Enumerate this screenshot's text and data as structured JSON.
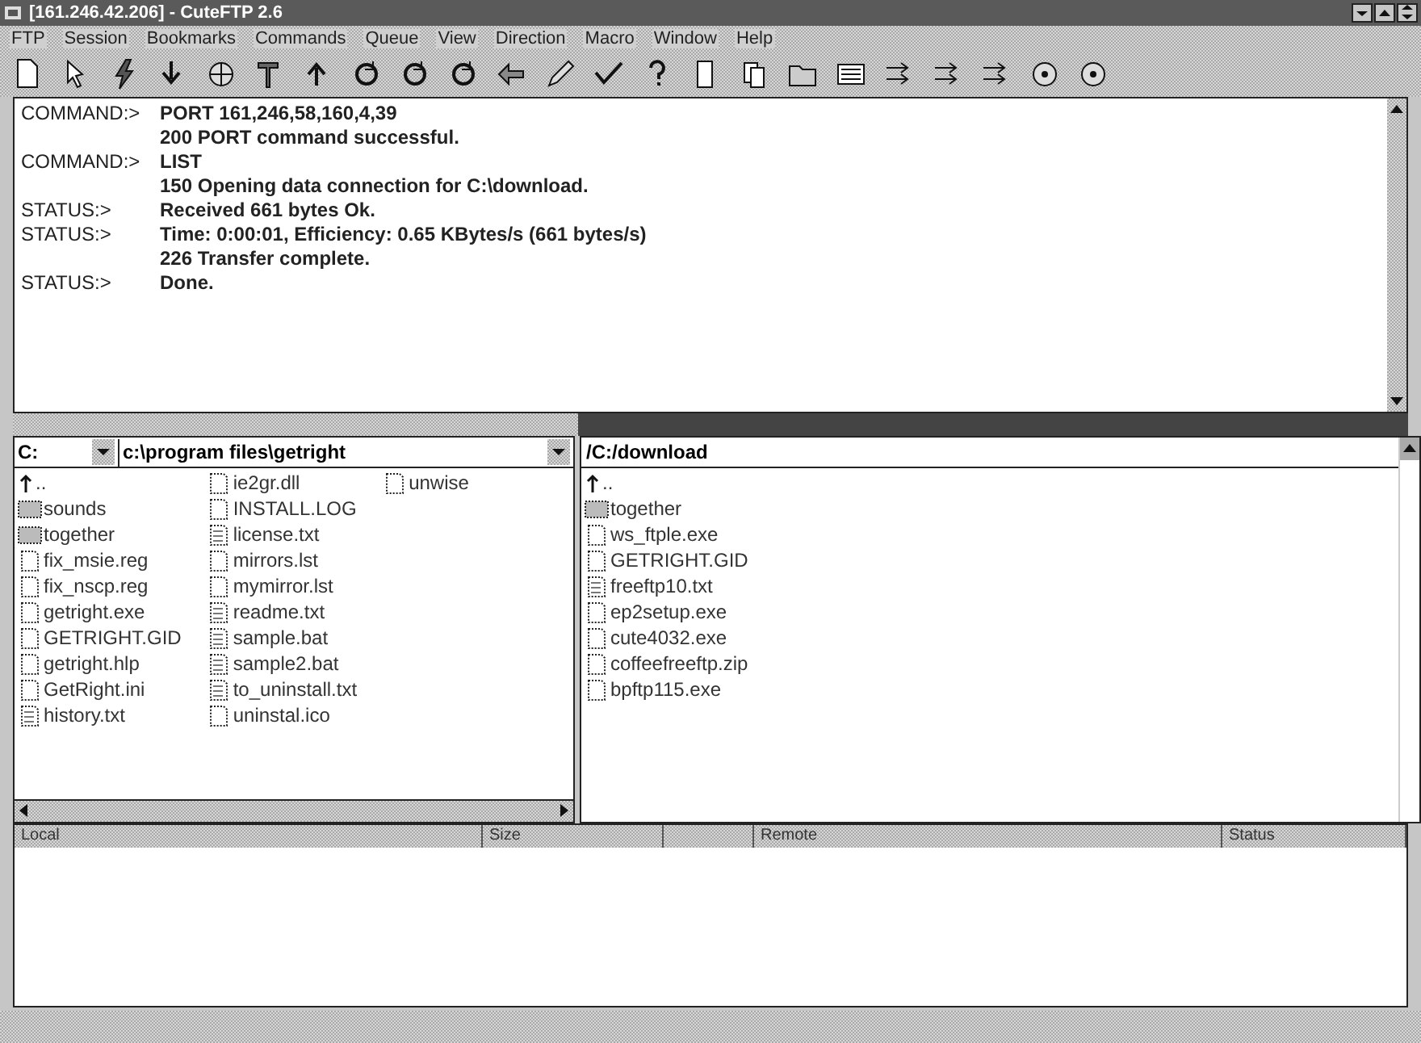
{
  "window": {
    "title": "[161.246.42.206] - CuteFTP 2.6"
  },
  "menu": [
    "FTP",
    "Session",
    "Bookmarks",
    "Commands",
    "Queue",
    "View",
    "Direction",
    "Macro",
    "Window",
    "Help"
  ],
  "log": [
    {
      "prefix": "COMMAND:>",
      "text": "PORT 161,246,58,160,4,39"
    },
    {
      "text": "200 PORT command successful."
    },
    {
      "prefix": "COMMAND:>",
      "text": "LIST"
    },
    {
      "text": "150 Opening data connection for C:\\download."
    },
    {
      "prefix": "STATUS:>",
      "text": "Received 661 bytes Ok."
    },
    {
      "prefix": "STATUS:>",
      "text": "Time: 0:00:01, Efficiency: 0.65 KBytes/s (661 bytes/s)"
    },
    {
      "text": "226 Transfer complete."
    },
    {
      "prefix": "STATUS:>",
      "text": "Done."
    }
  ],
  "local": {
    "drive": "C:",
    "path": "c:\\program files\\getright",
    "files": [
      {
        "kind": "up",
        "name": ".."
      },
      {
        "kind": "folder",
        "name": "sounds"
      },
      {
        "kind": "folder",
        "name": "together"
      },
      {
        "kind": "file",
        "name": "fix_msie.reg"
      },
      {
        "kind": "file",
        "name": "fix_nscp.reg"
      },
      {
        "kind": "file",
        "name": "getright.exe"
      },
      {
        "kind": "file",
        "name": "GETRIGHT.GID"
      },
      {
        "kind": "file",
        "name": "getright.hlp"
      },
      {
        "kind": "file",
        "name": "GetRight.ini"
      },
      {
        "kind": "text",
        "name": "history.txt"
      },
      {
        "kind": "file",
        "name": "ie2gr.dll"
      },
      {
        "kind": "file",
        "name": "INSTALL.LOG"
      },
      {
        "kind": "text",
        "name": "license.txt"
      },
      {
        "kind": "file",
        "name": "mirrors.lst"
      },
      {
        "kind": "file",
        "name": "mymirror.lst"
      },
      {
        "kind": "text",
        "name": "readme.txt"
      },
      {
        "kind": "text",
        "name": "sample.bat"
      },
      {
        "kind": "text",
        "name": "sample2.bat"
      },
      {
        "kind": "text",
        "name": "to_uninstall.txt"
      },
      {
        "kind": "file",
        "name": "uninstal.ico"
      },
      {
        "kind": "file",
        "name": "unwise"
      }
    ]
  },
  "remote": {
    "path": "/C:/download",
    "files": [
      {
        "kind": "up",
        "name": ".."
      },
      {
        "kind": "folder",
        "name": "together"
      },
      {
        "kind": "file",
        "name": "ws_ftple.exe"
      },
      {
        "kind": "file",
        "name": "GETRIGHT.GID"
      },
      {
        "kind": "text",
        "name": "freeftp10.txt"
      },
      {
        "kind": "file",
        "name": "ep2setup.exe"
      },
      {
        "kind": "file",
        "name": "cute4032.exe"
      },
      {
        "kind": "file",
        "name": "coffeefreeftp.zip"
      },
      {
        "kind": "file",
        "name": "bpftp115.exe"
      }
    ]
  },
  "queue": {
    "columns": [
      "Local",
      "Size",
      "Remote",
      "Status"
    ]
  }
}
